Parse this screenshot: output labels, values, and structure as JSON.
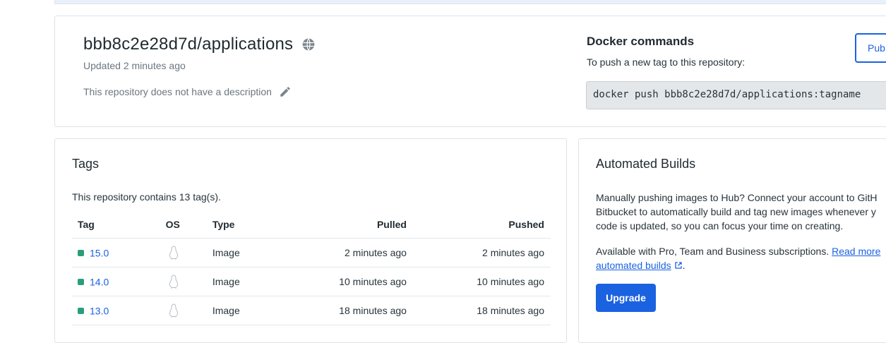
{
  "repo": {
    "title": "bbb8c2e28d7d/applications",
    "updated": "Updated 2 minutes ago",
    "description": "This repository does not have a description",
    "visibility_icon": "globe-icon",
    "edit_icon": "pencil-icon"
  },
  "docker": {
    "title": "Docker commands",
    "subtitle": "To push a new tag to this repository:",
    "command": "docker push bbb8c2e28d7d/applications:tagname",
    "public_button": "Pub"
  },
  "tags": {
    "title": "Tags",
    "count_text": "This repository contains 13 tag(s).",
    "columns": [
      "Tag",
      "OS",
      "Type",
      "Pulled",
      "Pushed"
    ],
    "rows": [
      {
        "tag": "15.0",
        "os": "linux-icon",
        "type": "Image",
        "pulled": "2 minutes ago",
        "pushed": "2 minutes ago"
      },
      {
        "tag": "14.0",
        "os": "linux-icon",
        "type": "Image",
        "pulled": "10 minutes ago",
        "pushed": "10 minutes ago"
      },
      {
        "tag": "13.0",
        "os": "linux-icon",
        "type": "Image",
        "pulled": "18 minutes ago",
        "pushed": "18 minutes ago"
      }
    ],
    "status_color": "#2a9d7c"
  },
  "builds": {
    "title": "Automated Builds",
    "text_line1": "Manually pushing images to Hub? Connect your account to GitH",
    "text_line2": "Bitbucket to automatically build and tag new images whenever y",
    "text_line3": "code is updated, so you can focus your time on creating.",
    "avail_text": "Available with Pro, Team and Business subscriptions.",
    "read_more": "Read more",
    "automated_builds_link": "automated builds",
    "period": ".",
    "upgrade_button": "Upgrade"
  },
  "colors": {
    "accent": "#1b62e1",
    "border": "#dde3e8"
  }
}
